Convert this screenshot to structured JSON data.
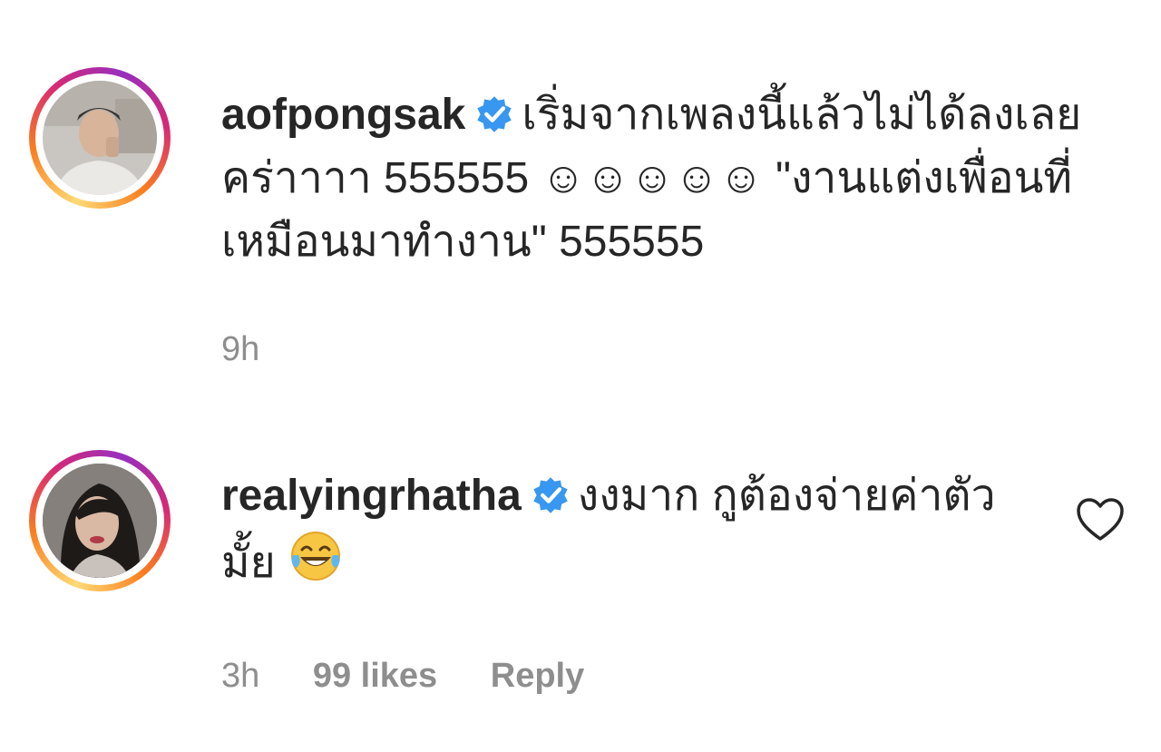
{
  "comments": [
    {
      "username": "aofpongsak",
      "verified": true,
      "text": "เริ่มจากเพลงนี้แล้วไม่ได้ลงเลยคร่าาาา 555555",
      "text_after_emoji": "\"งานแต่งเพื่อนที่เหมือนมาทำงาน\" 555555",
      "emojis": "☺☺☺☺☺",
      "time": "9h"
    },
    {
      "username": "realyingrhatha",
      "verified": true,
      "text": "งงมาก กูต้องจ่ายค่าตัวมั้ย",
      "emoji": "laughing-tears-emoji",
      "time": "3h",
      "likes": "99 likes",
      "reply_label": "Reply"
    }
  ],
  "colors": {
    "verified_blue": "#3897f0",
    "meta_gray": "#8e8e8e",
    "text": "#262626"
  }
}
